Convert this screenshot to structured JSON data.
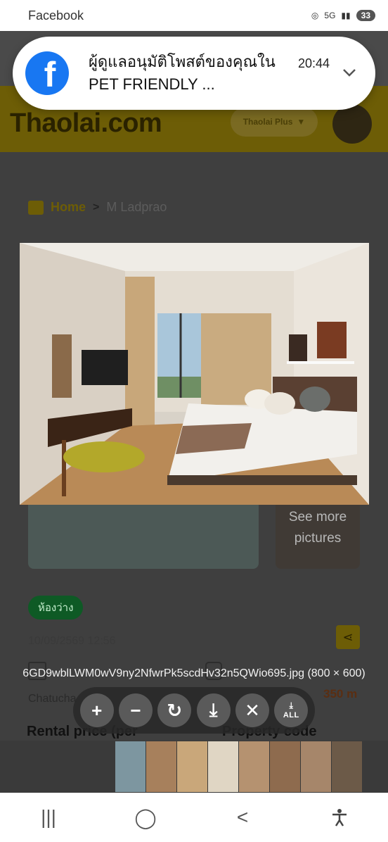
{
  "status_bar": {
    "app_label": "Facebook",
    "network": "5G",
    "battery": "33"
  },
  "notification": {
    "app_icon": "facebook-icon",
    "message": "ผู้ดูแลอนุมัติโพสต์ของคุณใน PET FRIENDLY ...",
    "time": "20:44"
  },
  "page": {
    "site_logo": "Thaolai.com",
    "plus_label": "Thaolai Plus",
    "breadcrumb": {
      "home": "Home",
      "current": "M Ladprao"
    },
    "see_more": "See more pictures",
    "availability_badge": "ห้องว่าง",
    "date": "10/09/2569 12:56",
    "district": "Chatucha",
    "distance": "350 m",
    "rent_label": "Rental price (per",
    "code_label": "Property code"
  },
  "viewer": {
    "file_caption": "6GD9wblLWM0wV9ny2NfwrPk5scdHv32n5QWio695.jpg (800 × 600)",
    "toolbar": {
      "zoom_in": "+",
      "zoom_out": "−",
      "rotate": "↻",
      "download": "⤓",
      "close": "✕",
      "download_all_label": "ALL"
    },
    "thumbnails": 8
  },
  "nav_bar": {
    "recents": "|||",
    "home": "◯",
    "back": "<",
    "accessibility": "accessibility-icon"
  }
}
